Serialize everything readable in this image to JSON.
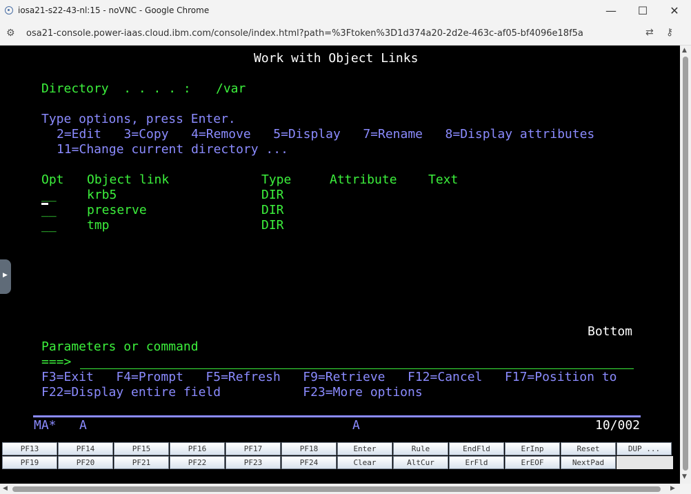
{
  "window": {
    "title": "iosa21-s22-43-nl:15 - noVNC - Google Chrome",
    "minimize_glyph": "—",
    "maximize_glyph": "☐",
    "close_glyph": "✕"
  },
  "address_bar": {
    "url": "osa21-console.power-iaas.cloud.ibm.com/console/index.html?path=%3Ftoken%3D1d374a20-2d2e-463c-af05-bf4096e18f5a",
    "site_info_icon": "tune-icon",
    "translate_icon": "translate-icon",
    "password_icon": "key-icon"
  },
  "terminal": {
    "header": "Work with Object Links",
    "directory_label": "Directory  . . . . :",
    "directory_value": "/var",
    "instructions": "Type options, press Enter.",
    "options_line1": "2=Edit   3=Copy   4=Remove   5=Display   7=Rename   8=Display attributes",
    "options_line2": "11=Change current directory ...",
    "columns": {
      "opt": "Opt",
      "object_link": "Object link",
      "type": "Type",
      "attribute": "Attribute",
      "text": "Text"
    },
    "rows": [
      {
        "opt": "__",
        "object_link": "krb5",
        "type": "DIR"
      },
      {
        "opt": "__",
        "object_link": "preserve",
        "type": "DIR"
      },
      {
        "opt": "__",
        "object_link": "tmp",
        "type": "DIR"
      }
    ],
    "bottom_label": "Bottom",
    "params_label": "Parameters or command",
    "prompt": "===>",
    "fkeys_line1": "F3=Exit   F4=Prompt   F5=Refresh   F9=Retrieve   F12=Cancel   F17=Position to",
    "fkeys_line2": "F22=Display entire field           F23=More options",
    "status_left": "MA*",
    "status_a1": "A",
    "status_a2": "A",
    "status_pos": "10/002"
  },
  "keypad": {
    "row1": [
      "PF13",
      "PF14",
      "PF15",
      "PF16",
      "PF17",
      "PF18",
      "Enter",
      "Rule",
      "EndFld",
      "ErInp",
      "Reset",
      "DUP ..."
    ],
    "row2": [
      "PF19",
      "PF20",
      "PF21",
      "PF22",
      "PF23",
      "PF24",
      "Clear",
      "AltCur",
      "ErFld",
      "ErEOF",
      "NextPad"
    ]
  }
}
